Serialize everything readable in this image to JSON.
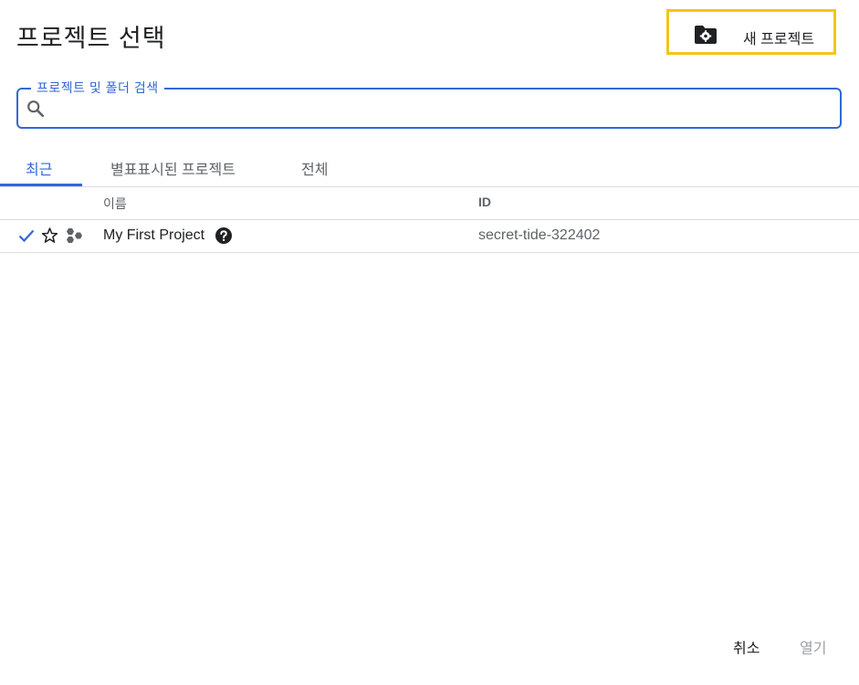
{
  "dialog": {
    "title": "프로젝트 선택",
    "new_project": {
      "label": "새 프로젝트",
      "icon": "folder-settings-icon",
      "highlight_color": "#f5c518"
    }
  },
  "search": {
    "label": "프로젝트 및 폴더 검색",
    "placeholder": "",
    "value": "",
    "icon": "search-icon"
  },
  "tabs": [
    {
      "label": "최근",
      "active": true
    },
    {
      "label": "별표표시된 프로젝트",
      "active": false
    },
    {
      "label": "전체",
      "active": false
    }
  ],
  "table": {
    "columns": [
      "이름",
      "ID"
    ],
    "rows": [
      {
        "name": "My First Project",
        "id": "secret-tide-322402",
        "selected": true,
        "starred": false
      }
    ]
  },
  "footer": {
    "cancel_label": "취소",
    "open_label": "열기"
  },
  "colors": {
    "accent": "#3367d6",
    "text": "#202124",
    "muted": "#5f6368",
    "disabled": "#9aa0a6"
  }
}
